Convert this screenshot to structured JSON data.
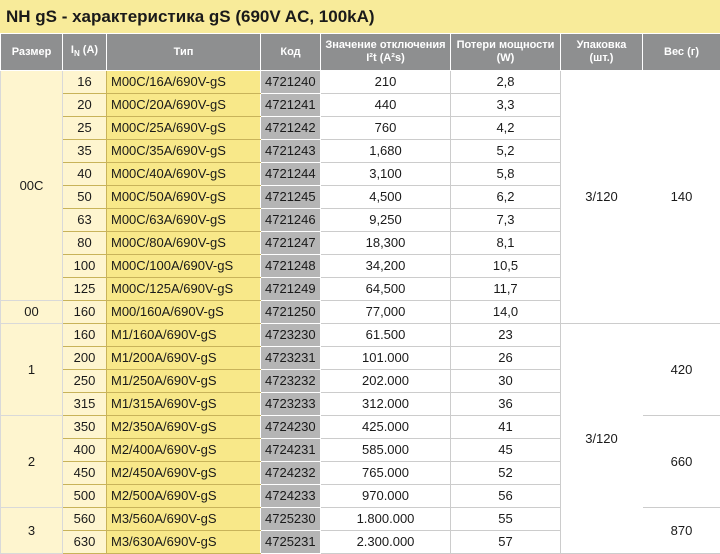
{
  "title": "NH gS - характеристика gS (690V AC, 100kA)",
  "headers": {
    "size": "Размер",
    "current_prefix": "I",
    "current_sub": "N",
    "current_suffix": " (A)",
    "type": "Тип",
    "code": "Код",
    "i2t_line1": "Значение отключения",
    "i2t_line2": "I²t (A²s)",
    "loss_line1": "Потери мощности",
    "loss_line2": "(W)",
    "pack_line1": "Упаковка",
    "pack_line2": "(шт.)",
    "weight": "Вес (г)"
  },
  "rows": [
    {
      "current": "16",
      "type": "M00C/16A/690V-gS",
      "code": "4721240",
      "i2t": "210",
      "loss": "2,8"
    },
    {
      "current": "20",
      "type": "M00C/20A/690V-gS",
      "code": "4721241",
      "i2t": "440",
      "loss": "3,3"
    },
    {
      "current": "25",
      "type": "M00C/25A/690V-gS",
      "code": "4721242",
      "i2t": "760",
      "loss": "4,2"
    },
    {
      "current": "35",
      "type": "M00C/35A/690V-gS",
      "code": "4721243",
      "i2t": "1,680",
      "loss": "5,2"
    },
    {
      "current": "40",
      "type": "M00C/40A/690V-gS",
      "code": "4721244",
      "i2t": "3,100",
      "loss": "5,8"
    },
    {
      "current": "50",
      "type": "M00C/50A/690V-gS",
      "code": "4721245",
      "i2t": "4,500",
      "loss": "6,2"
    },
    {
      "current": "63",
      "type": "M00C/63A/690V-gS",
      "code": "4721246",
      "i2t": "9,250",
      "loss": "7,3"
    },
    {
      "current": "80",
      "type": "M00C/80A/690V-gS",
      "code": "4721247",
      "i2t": "18,300",
      "loss": "8,1"
    },
    {
      "current": "100",
      "type": "M00C/100A/690V-gS",
      "code": "4721248",
      "i2t": "34,200",
      "loss": "10,5"
    },
    {
      "current": "125",
      "type": "M00C/125A/690V-gS",
      "code": "4721249",
      "i2t": "64,500",
      "loss": "11,7"
    },
    {
      "current": "160",
      "type": "M00/160A/690V-gS",
      "code": "4721250",
      "i2t": "77,000",
      "loss": "14,0"
    },
    {
      "current": "160",
      "type": "M1/160A/690V-gS",
      "code": "4723230",
      "i2t": "61.500",
      "loss": "23"
    },
    {
      "current": "200",
      "type": "M1/200A/690V-gS",
      "code": "4723231",
      "i2t": "101.000",
      "loss": "26"
    },
    {
      "current": "250",
      "type": "M1/250A/690V-gS",
      "code": "4723232",
      "i2t": "202.000",
      "loss": "30"
    },
    {
      "current": "315",
      "type": "M1/315A/690V-gS",
      "code": "4723233",
      "i2t": "312.000",
      "loss": "36"
    },
    {
      "current": "350",
      "type": "M2/350A/690V-gS",
      "code": "4724230",
      "i2t": "425.000",
      "loss": "41"
    },
    {
      "current": "400",
      "type": "M2/400A/690V-gS",
      "code": "4724231",
      "i2t": "585.000",
      "loss": "45"
    },
    {
      "current": "450",
      "type": "M2/450A/690V-gS",
      "code": "4724232",
      "i2t": "765.000",
      "loss": "52"
    },
    {
      "current": "500",
      "type": "M2/500A/690V-gS",
      "code": "4724233",
      "i2t": "970.000",
      "loss": "56"
    },
    {
      "current": "560",
      "type": "M3/560A/690V-gS",
      "code": "4725230",
      "i2t": "1.800.000",
      "loss": "55"
    },
    {
      "current": "630",
      "type": "M3/630A/690V-gS",
      "code": "4725231",
      "i2t": "2.300.000",
      "loss": "57"
    }
  ],
  "size_groups": [
    {
      "label": "00C"
    },
    {
      "label": "00"
    },
    {
      "label": "1"
    },
    {
      "label": "2"
    },
    {
      "label": "3"
    }
  ],
  "pack_groups": [
    {
      "label": "3/120"
    },
    {
      "label": "3/120"
    }
  ],
  "weight_groups": [
    {
      "label": "140"
    },
    {
      "label": "420"
    },
    {
      "label": "660"
    },
    {
      "label": "870"
    }
  ],
  "colors": {
    "title_bg": "#f8eb9a",
    "header_bg": "#8e8f90",
    "group_bg": "#fef5cf",
    "type_bg": "#f8e889",
    "code_bg": "#b5b5b5"
  }
}
